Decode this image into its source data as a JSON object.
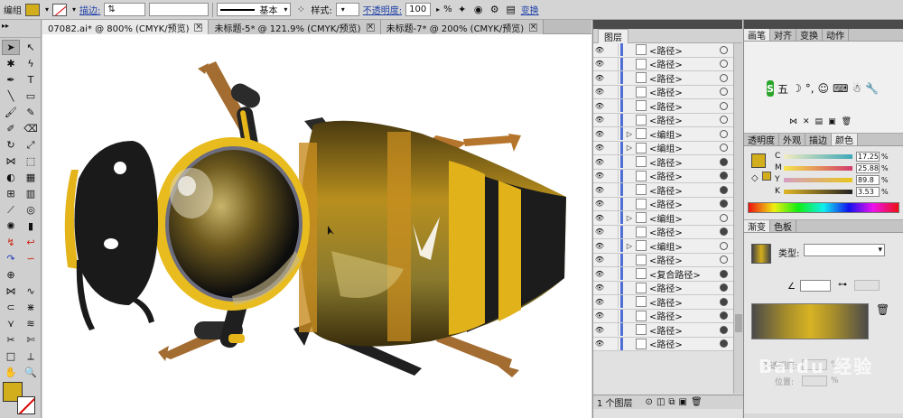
{
  "control_bar": {
    "selection_label": "编组",
    "fill_color": "#d3ae1c",
    "stroke_label": "描边:",
    "stroke_style": "基本",
    "style_label": "样式:",
    "opacity_label": "不透明度:",
    "opacity_value": "100",
    "opacity_unit": "%",
    "transform_label": "变换"
  },
  "tabs": [
    {
      "label": "07082.ai* @ 800% (CMYK/预览)"
    },
    {
      "label": "未标题-5* @ 121.9% (CMYK/预览)"
    },
    {
      "label": "未标题-7* @ 200% (CMYK/预览)"
    }
  ],
  "layers_panel": {
    "title": "图层",
    "rows": [
      {
        "name": "<路径>",
        "expand": "",
        "eye": true,
        "target_filled": false
      },
      {
        "name": "<路径>",
        "expand": "",
        "eye": true,
        "target_filled": false
      },
      {
        "name": "<路径>",
        "expand": "",
        "eye": true,
        "target_filled": false
      },
      {
        "name": "<路径>",
        "expand": "",
        "eye": true,
        "target_filled": false
      },
      {
        "name": "<路径>",
        "expand": "",
        "eye": true,
        "target_filled": false
      },
      {
        "name": "<路径>",
        "expand": "",
        "eye": true,
        "target_filled": false
      },
      {
        "name": "<编组>",
        "expand": "▷",
        "eye": true,
        "target_filled": false
      },
      {
        "name": "<编组>",
        "expand": "▷",
        "eye": true,
        "target_filled": false
      },
      {
        "name": "<路径>",
        "expand": "",
        "eye": true,
        "target_filled": true
      },
      {
        "name": "<路径>",
        "expand": "",
        "eye": true,
        "target_filled": true
      },
      {
        "name": "<路径>",
        "expand": "",
        "eye": true,
        "target_filled": true
      },
      {
        "name": "<路径>",
        "expand": "",
        "eye": true,
        "target_filled": true
      },
      {
        "name": "<编组>",
        "expand": "▷",
        "eye": true,
        "target_filled": false
      },
      {
        "name": "<路径>",
        "expand": "",
        "eye": true,
        "target_filled": true
      },
      {
        "name": "<编组>",
        "expand": "▷",
        "eye": true,
        "target_filled": false
      },
      {
        "name": "<路径>",
        "expand": "",
        "eye": true,
        "target_filled": false
      },
      {
        "name": "<复合路径>",
        "expand": "",
        "eye": true,
        "target_filled": true
      },
      {
        "name": "<路径>",
        "expand": "",
        "eye": true,
        "target_filled": true
      },
      {
        "name": "<路径>",
        "expand": "",
        "eye": true,
        "target_filled": true
      },
      {
        "name": "<路径>",
        "expand": "",
        "eye": true,
        "target_filled": true
      },
      {
        "name": "<路径>",
        "expand": "",
        "eye": true,
        "target_filled": true
      },
      {
        "name": "<路径>",
        "expand": "",
        "eye": true,
        "target_filled": true
      }
    ],
    "footer_count": "1 个图层"
  },
  "panel_tabs_top": [
    "画笔",
    "对齐",
    "变换",
    "动作"
  ],
  "ime_bar": {
    "logo": "S",
    "label": "五"
  },
  "panel_tabs_color": [
    "透明度",
    "外观",
    "描边",
    "颜色"
  ],
  "color": {
    "swatch": "#d3ae1c",
    "channels": [
      {
        "label": "C",
        "value": "17.25",
        "gradient": "linear-gradient(90deg,#f2ecc0,#3ca8b8)"
      },
      {
        "label": "M",
        "value": "25.88",
        "gradient": "linear-gradient(90deg,#f6e64a,#d13a6d)"
      },
      {
        "label": "Y",
        "value": "89.8",
        "gradient": "linear-gradient(90deg,#d59ec3,#e8c61a)"
      },
      {
        "label": "K",
        "value": "3.53",
        "gradient": "linear-gradient(90deg,#e0b625,#222)"
      }
    ],
    "unit": "%"
  },
  "panel_tabs_gradient": [
    "渐变",
    "色板"
  ],
  "gradient": {
    "type_label": "类型:",
    "opacity_label": "不透明度:",
    "position_label": "位置:",
    "unit": "%"
  },
  "watermark": "Baidu 经验"
}
